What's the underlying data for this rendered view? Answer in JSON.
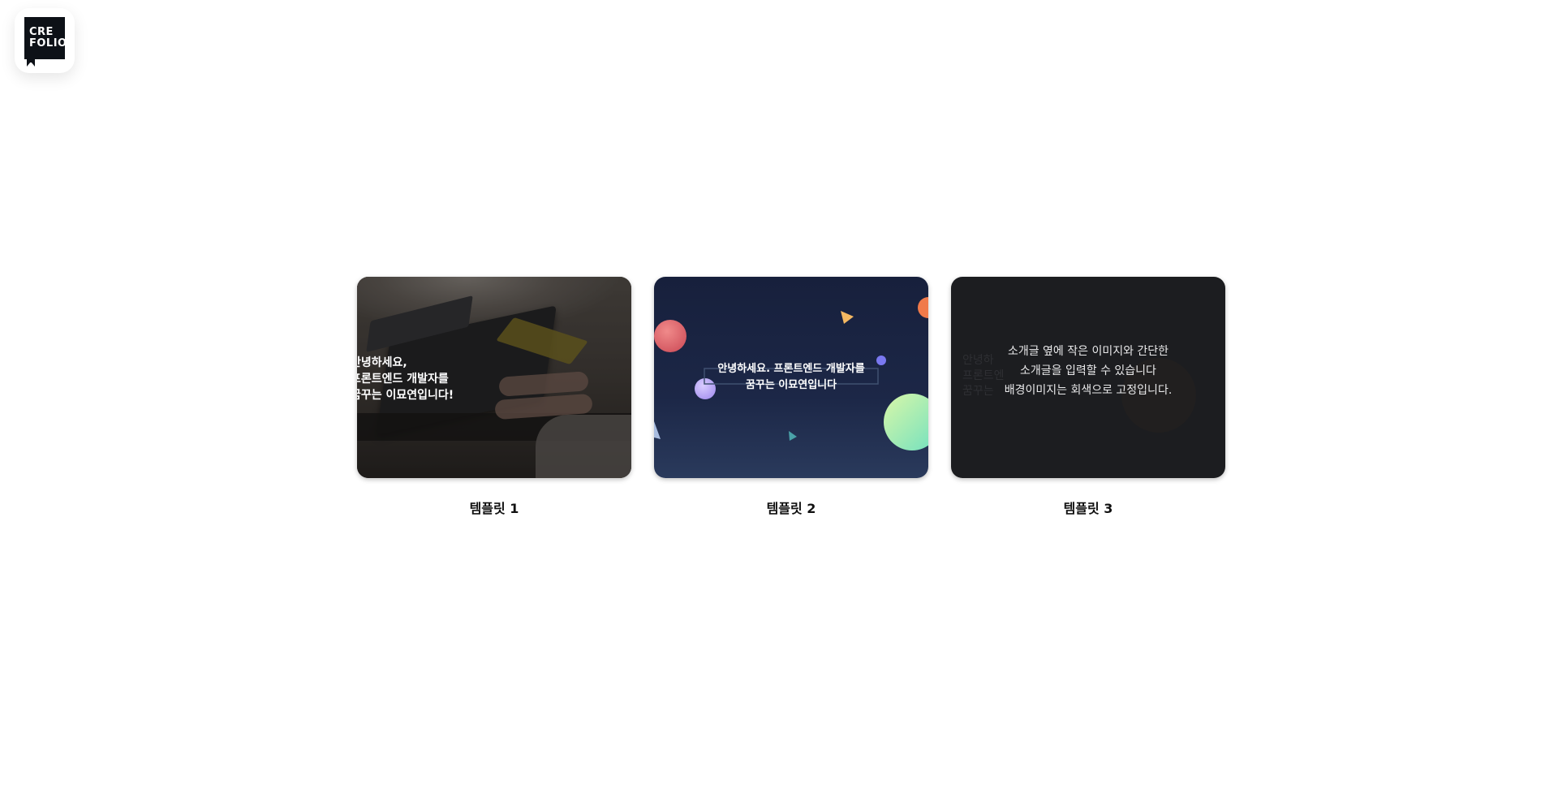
{
  "logo": {
    "line1": "CRE",
    "line2": "FOLIO"
  },
  "templates": [
    {
      "label": "템플릿 1",
      "intro": "안녕하세요,\n프론트엔드 개발자를\n꿈꾸는 이묘연입니다!"
    },
    {
      "label": "템플릿 2",
      "intro": "안녕하세요. 프론트엔드 개발자를\n꿈꾸는 이묘연입니다"
    },
    {
      "label": "템플릿 3",
      "intro": "소개글 옆에 작은 이미지와 간단한\n소개글을 입력할 수 있습니다\n배경이미지는 회색으로 고정입니다.",
      "ghost_text": "안녕하\n프론트엔\n꿈꾸는"
    }
  ],
  "colors": {
    "logo_bg": "#0d1117",
    "card2_bg": "#17203c",
    "card3_bg": "#1c1d20"
  }
}
